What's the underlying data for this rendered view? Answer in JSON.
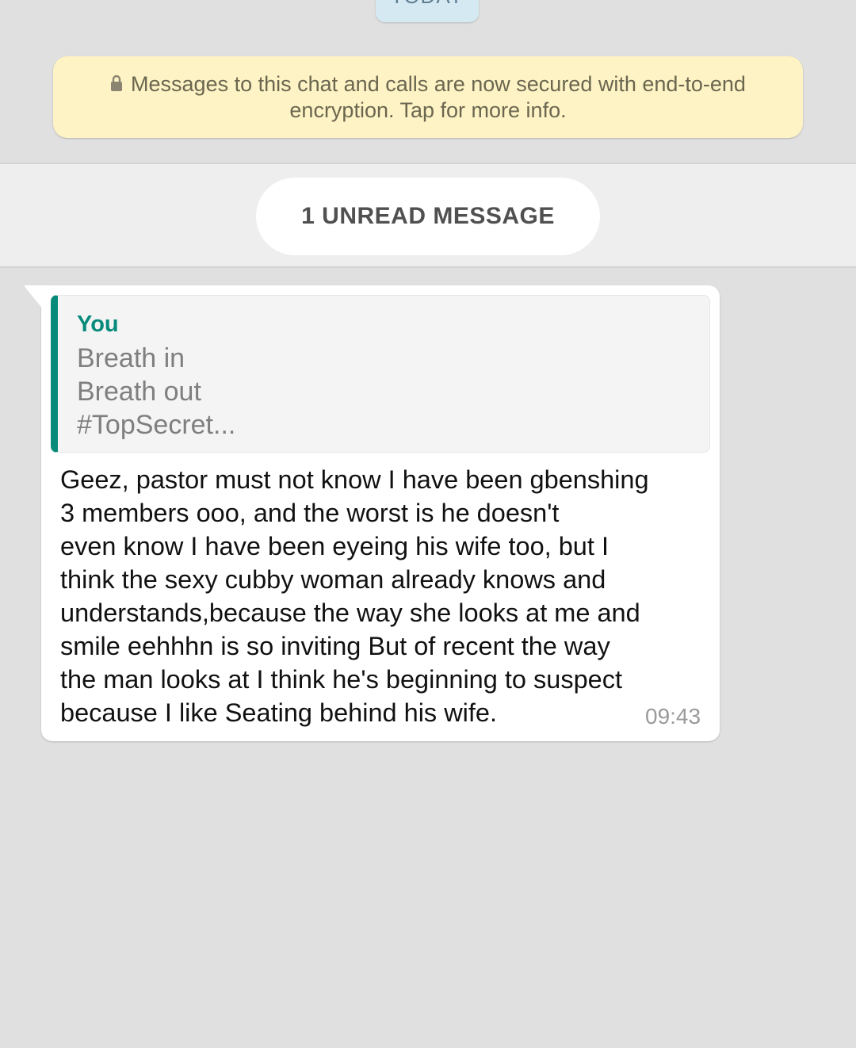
{
  "date_chip": {
    "label": "TODAY"
  },
  "encryption_notice": {
    "icon": "lock-icon",
    "text": "Messages to this chat and calls are now secured with end-to-end encryption. Tap for more info."
  },
  "unread_divider": {
    "label": "1 UNREAD MESSAGE"
  },
  "message": {
    "quoted": {
      "author": "You",
      "lines": [
        "Breath in",
        "Breath out",
        "#TopSecret..."
      ]
    },
    "lines": [
      "Geez, pastor must not know I have been gbenshing",
      "3 members ooo, and the worst is he doesn't",
      "even know I have been eyeing his wife too, but I",
      "think the sexy cubby woman already knows and",
      "understands,because the way she looks at me and",
      "smile eehhhn is so inviting But of recent the way",
      "the man looks at I think he's beginning to suspect",
      "because I like Seating behind his wife."
    ],
    "time": "09:43"
  },
  "colors": {
    "chat_background": "#e0e0e0",
    "encryption_banner": "#fdf3c4",
    "quote_accent": "#068b7b",
    "bubble": "#ffffff"
  }
}
